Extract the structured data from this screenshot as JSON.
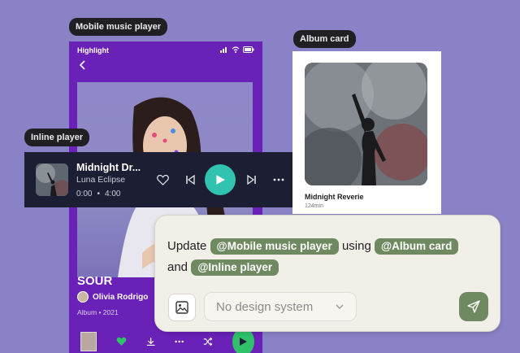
{
  "labels": {
    "mobile_player": "Mobile music player",
    "album_card": "Album card",
    "inline_player": "Inline player"
  },
  "mobile_player": {
    "status_text": "Highlight",
    "title": "SOUR",
    "artist": "Olivia Rodrigo",
    "album_meta": "Album • 2021"
  },
  "album_card": {
    "title": "Midnight Reverie",
    "duration": "124min"
  },
  "inline_player": {
    "title": "Midnight Dr...",
    "artist": "Luna Eclipse",
    "elapsed": "0:00",
    "separator": "•",
    "total": "4:00"
  },
  "composer": {
    "prefix": "Update",
    "mention1": "@Mobile music player",
    "middle": "using",
    "mention2": "@Album card",
    "joiner": "and",
    "mention3": "@Inline player",
    "design_system": "No design system"
  },
  "colors": {
    "background": "#8a82c6",
    "phone_bg": "#6a21b8",
    "mention_bg": "#6f8a61",
    "inline_play": "#31c2b0",
    "phone_play": "#2fc26a"
  }
}
